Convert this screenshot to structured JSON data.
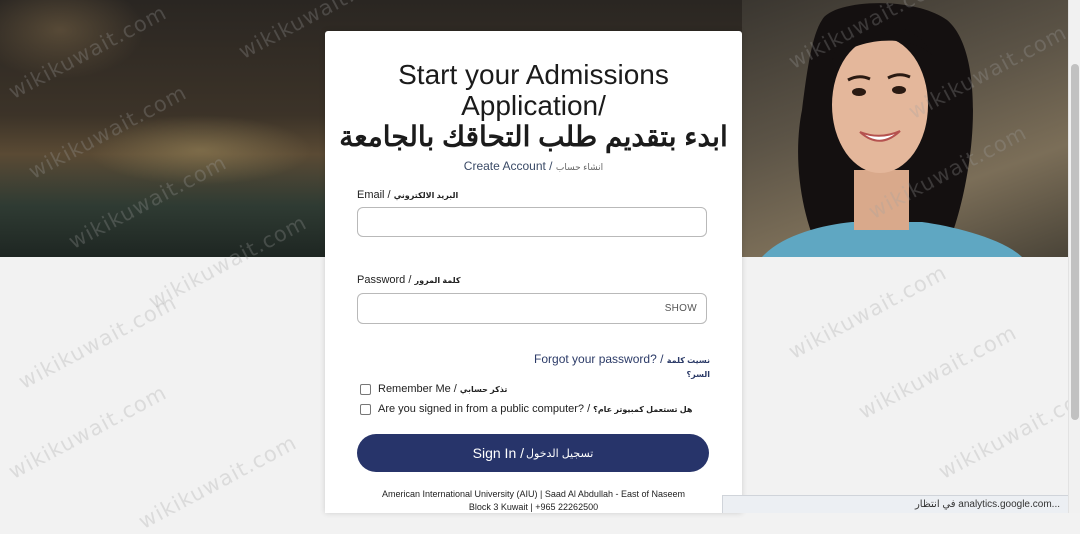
{
  "form": {
    "title_en": "Start your Admissions Application/",
    "title_ar": "ابدء بتقديم طلب التحاقك بالجامعة",
    "subtitle_en": "Create Account /",
    "subtitle_ar": "انشاء حساب",
    "email_label_en": "Email /",
    "email_label_ar": "البريد الالكتروني",
    "email_value": "",
    "password_label_en": "Password /",
    "password_label_ar": "كلمة المرور",
    "password_value": "",
    "show_toggle": "SHOW",
    "forgot_en": "Forgot your password? /",
    "forgot_ar": "نسيت كلمة السر؟",
    "remember_en": "Remember Me /",
    "remember_ar": "تذكر حسابي",
    "public_en": "Are you signed in from a public computer? /",
    "public_ar": "هل تستعمل كمبيوتر عام؟",
    "signin_en": "Sign In /",
    "signin_ar": "تسجيل الدخول",
    "footer_line1": "American International University (AIU) | Saad Al Abdullah - East of Naseem",
    "footer_line2": "Block 3 Kuwait | +965 22262500"
  },
  "status_bar": {
    "text": "في انتظار analytics.google.com..."
  },
  "watermark": "wikikuwait.com",
  "colors": {
    "primary_button": "#27346a",
    "link": "#2b3a67",
    "page_background": "#f2f2f2"
  }
}
